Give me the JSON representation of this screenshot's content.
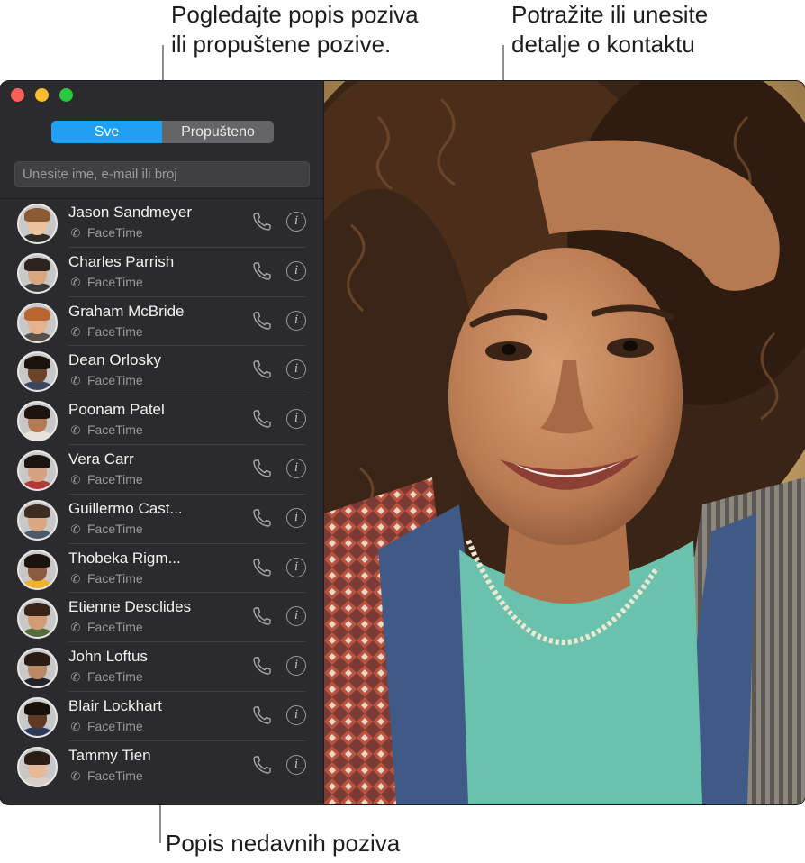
{
  "callouts": {
    "filter": "Pogledajte popis poziva\nili propuštene pozive.",
    "search": "Potražite ili unesite\ndetalje o kontaktu",
    "recents": "Popis nedavnih poziva"
  },
  "colors": {
    "accent": "#1fa0f2",
    "close": "#fe5f57",
    "minimize": "#febc2e",
    "zoom": "#28c840"
  },
  "filter": {
    "all_label": "Sve",
    "missed_label": "Propušteno",
    "selected": "Sve"
  },
  "search": {
    "placeholder": "Unesite ime, e-mail ili broj"
  },
  "calls": [
    {
      "name": "Jason Sandmeyer",
      "type": "FaceTime"
    },
    {
      "name": "Charles Parrish",
      "type": "FaceTime"
    },
    {
      "name": "Graham McBride",
      "type": "FaceTime"
    },
    {
      "name": "Dean Orlosky",
      "type": "FaceTime"
    },
    {
      "name": "Poonam Patel",
      "type": "FaceTime"
    },
    {
      "name": "Vera Carr",
      "type": "FaceTime"
    },
    {
      "name": "Guillermo Cast...",
      "type": "FaceTime"
    },
    {
      "name": "Thobeka Rigm...",
      "type": "FaceTime"
    },
    {
      "name": "Etienne Desclides",
      "type": "FaceTime"
    },
    {
      "name": "John Loftus",
      "type": "FaceTime"
    },
    {
      "name": "Blair Lockhart",
      "type": "FaceTime"
    },
    {
      "name": "Tammy Tien",
      "type": "FaceTime"
    }
  ],
  "icons": {
    "call": "phone-icon",
    "info": "info-icon",
    "call_type": "phone-small-icon"
  }
}
